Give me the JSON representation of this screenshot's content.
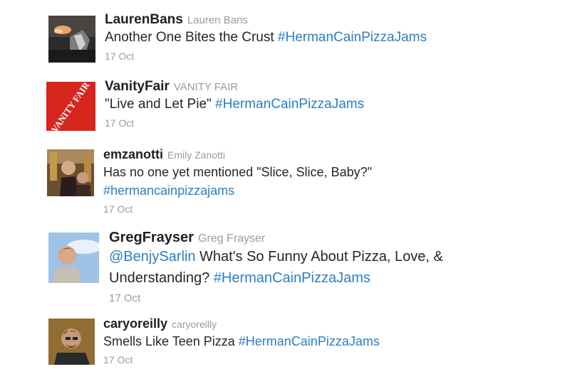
{
  "tweets": [
    {
      "screen_name": "LaurenBans",
      "full_name": "Lauren Bans",
      "text_lines": [
        {
          "plain": "Another One Bites the Crust ",
          "link": "#HermanCainPizzaJams"
        }
      ],
      "timestamp": "17 Oct"
    },
    {
      "screen_name": "VanityFair",
      "full_name": "VANITY FAIR",
      "avatar_logo_text": "VANITY FAIR",
      "text_lines": [
        {
          "plain": "\"Live and Let Pie\" ",
          "link": "#HermanCainPizzaJams"
        }
      ],
      "timestamp": "17 Oct"
    },
    {
      "screen_name": "emzanotti",
      "full_name": "Emily Zanotti",
      "text_lines": [
        {
          "plain": "Has no one yet mentioned \"Slice, Slice, Baby?\""
        },
        {
          "link": "#hermancainpizzajams"
        }
      ],
      "timestamp": "17 Oct"
    },
    {
      "screen_name": "GregFrayser",
      "full_name": "Greg Frayser",
      "text_lines": [
        {
          "mention": "@BenjySarlin",
          "plain": " What's So Funny About Pizza, Love, &"
        },
        {
          "plain": "Understanding? ",
          "link": "#HermanCainPizzaJams"
        }
      ],
      "timestamp": "17 Oct"
    },
    {
      "screen_name": "caryoreilly",
      "full_name": "caryoreilly",
      "text_lines": [
        {
          "plain": "Smells Like Teen Pizza ",
          "link": "#HermanCainPizzaJams"
        }
      ],
      "timestamp": "17 Oct"
    }
  ],
  "colors": {
    "link": "#2a7fc3",
    "screen_name": "#1f1f1f",
    "meta": "#9a9a9a",
    "vanity_fair_red": "#d7261d"
  }
}
